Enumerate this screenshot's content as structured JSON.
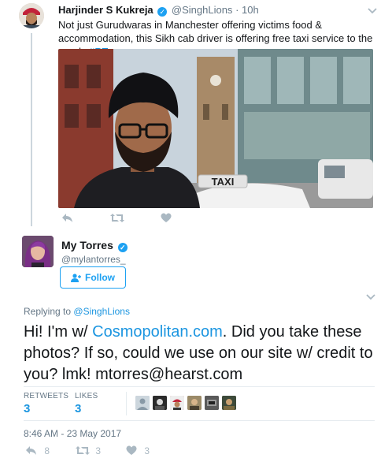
{
  "original_tweet": {
    "display_name": "Harjinder S Kukreja",
    "handle": "@SinghLions",
    "separator": "·",
    "time": "10h",
    "text": "Not just Gurudwaras in Manchester offering victims food & accommodation, this Sikh cab driver is offering free taxi service to the needy",
    "hashtag": "#RT",
    "photo_sign_text": "TAXI",
    "actions": {
      "reply_icon": "reply-icon",
      "retweet_icon": "retweet-icon",
      "like_icon": "heart-icon"
    }
  },
  "reply_tweet": {
    "display_name": "My Torres",
    "handle": "@mylantorres_",
    "follow_label": "Follow",
    "replying_prefix": "Replying to",
    "replying_to": "@SinghLions",
    "text_before_link": "Hi! I'm w/ ",
    "link_text": "Cosmopolitan.com",
    "text_after_link": ". Did you take these photos? If so, could we use on our site w/ credit to you? lmk! mtorres@hearst.com",
    "stats": {
      "retweets_label": "RETWEETS",
      "retweets_value": "3",
      "likes_label": "LIKES",
      "likes_value": "3"
    },
    "timestamp": "8:46 AM - 23 May 2017",
    "bottom_actions": {
      "reply_count": "8",
      "retweet_count": "3",
      "like_count": "3"
    }
  },
  "colors": {
    "link": "#1b95e0",
    "verified": "#1da1f2",
    "muted": "#657786",
    "icon": "#aab8c2"
  }
}
